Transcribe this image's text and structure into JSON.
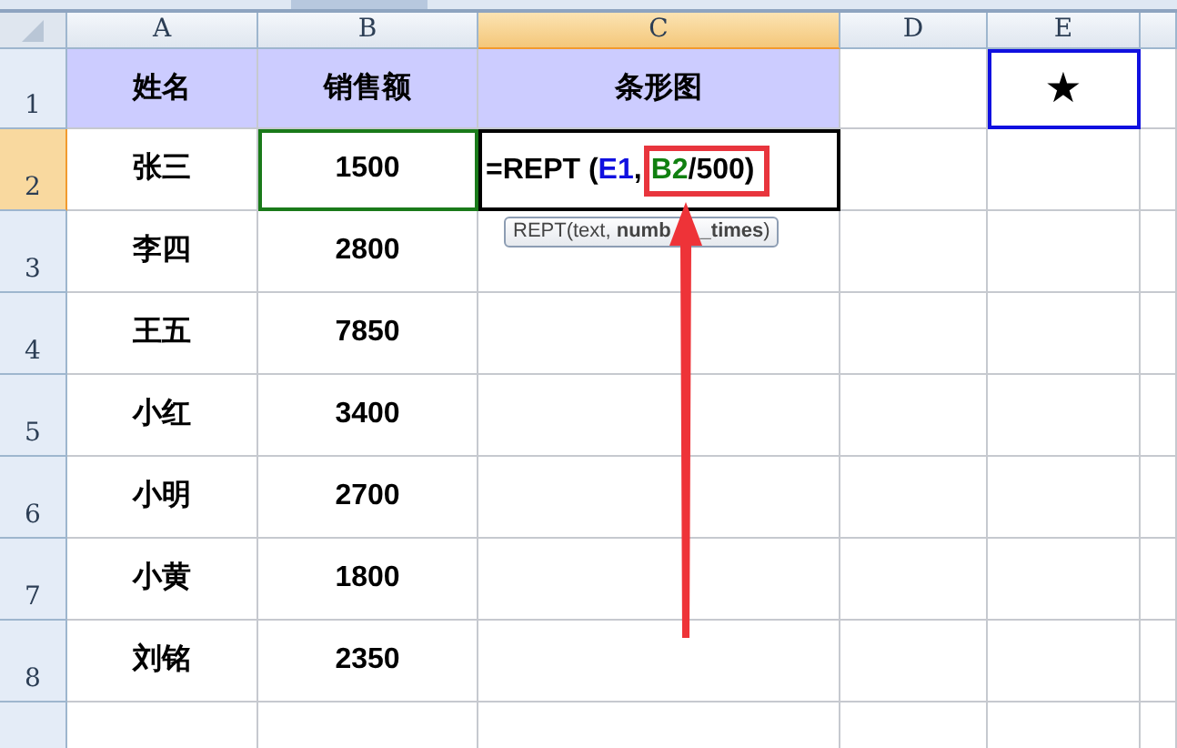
{
  "columns": [
    {
      "label": "A",
      "selected": false
    },
    {
      "label": "B",
      "selected": false
    },
    {
      "label": "C",
      "selected": true
    },
    {
      "label": "D",
      "selected": false
    },
    {
      "label": "E",
      "selected": false
    }
  ],
  "header_row": {
    "number": "1",
    "selected": false,
    "cells": [
      {
        "text": "姓名"
      },
      {
        "text": "销售额"
      },
      {
        "text": "条形图"
      }
    ],
    "e_cell": {
      "text": "★",
      "referenced": true
    }
  },
  "data_rows": [
    {
      "number": "2",
      "selected": true,
      "name": "张三",
      "sales": "1500",
      "sales_selected": true,
      "bar_cell": {
        "parts": [
          {
            "text": "=REPT (",
            "color": "#000000",
            "highlighted": false
          },
          {
            "text": "E1",
            "color": "#1010e0",
            "highlighted": false
          },
          {
            "text": ", ",
            "color": "#000000",
            "highlighted": false
          },
          {
            "text": "B2",
            "color": "#108010",
            "highlighted": true
          },
          {
            "text": "/500)",
            "color": "#000000",
            "highlighted": true
          }
        ],
        "tooltip": [
          "REPT(text, **numb**",
          "**_times**)"
        ]
      }
    },
    {
      "number": "3",
      "selected": false,
      "name": "李四",
      "sales": "2800",
      "sales_selected": false
    },
    {
      "number": "4",
      "selected": false,
      "name": "王五",
      "sales": "7850",
      "sales_selected": false
    },
    {
      "number": "5",
      "selected": false,
      "name": "小红",
      "sales": "3400",
      "sales_selected": false
    },
    {
      "number": "6",
      "selected": false,
      "name": "小明",
      "sales": "2700",
      "sales_selected": false
    },
    {
      "number": "7",
      "selected": false,
      "name": "小黄",
      "sales": "1800",
      "sales_selected": false
    },
    {
      "number": "8",
      "selected": false,
      "name": "刘铭",
      "sales": "2350",
      "sales_selected": false
    }
  ]
}
